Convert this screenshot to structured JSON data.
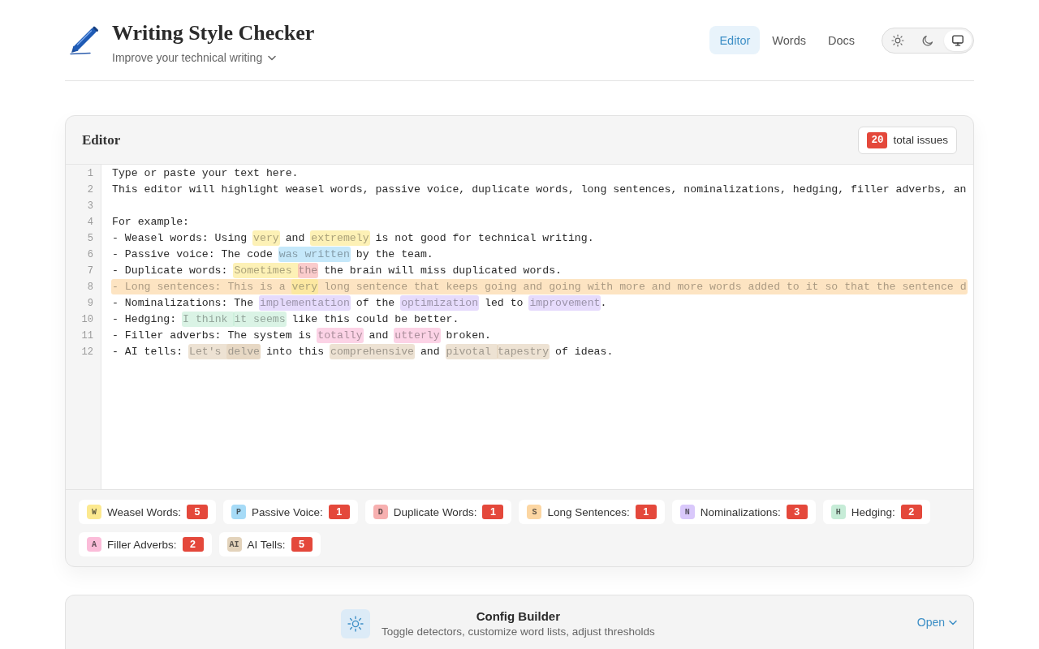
{
  "header": {
    "title": "Writing Style Checker",
    "subtitle": "Improve your technical writing",
    "nav": [
      {
        "label": "Editor",
        "selected": true
      },
      {
        "label": "Words",
        "selected": false
      },
      {
        "label": "Docs",
        "selected": false
      }
    ],
    "theme_modes": [
      {
        "kind": "light",
        "selected": false
      },
      {
        "kind": "dark",
        "selected": false
      },
      {
        "kind": "system",
        "selected": true
      }
    ]
  },
  "editor": {
    "title": "Editor",
    "issue_count": "20",
    "issue_label": "total issues",
    "lines": [
      {
        "number": "1",
        "segments": [
          {
            "kind": "plain",
            "text": "Type or paste your text here."
          }
        ]
      },
      {
        "number": "2",
        "segments": [
          {
            "kind": "plain",
            "text": "This editor will highlight weasel words, passive voice, duplicate words, long sentences, nominalizations, hedging, filler adverbs, an"
          }
        ]
      },
      {
        "number": "3"
      },
      {
        "number": "4",
        "segments": [
          {
            "kind": "plain",
            "text": "For example:"
          }
        ]
      },
      {
        "number": "5",
        "segments": [
          {
            "kind": "plain",
            "text": "- Weasel words: Using "
          },
          {
            "kind": "weasel",
            "text": "very"
          },
          {
            "kind": "plain",
            "text": " and "
          },
          {
            "kind": "weasel",
            "text": "extremely"
          },
          {
            "kind": "plain",
            "text": " is not good for technical writing."
          }
        ]
      },
      {
        "number": "6",
        "segments": [
          {
            "kind": "plain",
            "text": "- Passive voice: The code "
          },
          {
            "kind": "passive",
            "text": "was written"
          },
          {
            "kind": "plain",
            "text": " by the team."
          }
        ]
      },
      {
        "number": "7",
        "segments": [
          {
            "kind": "plain",
            "text": "- Duplicate words: "
          },
          {
            "kind": "weasel",
            "text": "Sometimes "
          },
          {
            "kind": "duplicate",
            "text": "the"
          },
          {
            "kind": "plain",
            "text": " the brain will miss duplicated words."
          }
        ]
      },
      {
        "number": "8",
        "segments": [
          {
            "kind": "long",
            "segments": [
              {
                "kind": "plain",
                "text": "- Long sentences: This is a "
              },
              {
                "kind": "weasel",
                "text": "very"
              },
              {
                "kind": "plain",
                "text": " long sentence that keeps going and going with more and more words added to it so that the sentence d"
              }
            ]
          }
        ]
      },
      {
        "number": "9",
        "segments": [
          {
            "kind": "plain",
            "text": "- Nominalizations: The "
          },
          {
            "kind": "nominalization",
            "text": "implementation"
          },
          {
            "kind": "plain",
            "text": " of the "
          },
          {
            "kind": "nominalization",
            "text": "optimization"
          },
          {
            "kind": "plain",
            "text": " led to "
          },
          {
            "kind": "nominalization",
            "text": "improvement"
          },
          {
            "kind": "plain",
            "text": "."
          }
        ]
      },
      {
        "number": "10",
        "segments": [
          {
            "kind": "plain",
            "text": "- Hedging: "
          },
          {
            "kind": "hedging",
            "text": "I think "
          },
          {
            "kind": "hedging",
            "text": "it seems"
          },
          {
            "kind": "plain",
            "text": " like this could be better."
          }
        ]
      },
      {
        "number": "11",
        "segments": [
          {
            "kind": "plain",
            "text": "- Filler adverbs: The system is "
          },
          {
            "kind": "filler",
            "text": "totally"
          },
          {
            "kind": "plain",
            "text": " and "
          },
          {
            "kind": "filler",
            "text": "utterly"
          },
          {
            "kind": "plain",
            "text": " broken."
          }
        ]
      },
      {
        "number": "12",
        "segments": [
          {
            "kind": "plain",
            "text": "- AI tells: "
          },
          {
            "kind": "ai",
            "segments": [
              {
                "kind": "plain",
                "text": "Let's "
              },
              {
                "kind": "ai",
                "text": "delve"
              }
            ]
          },
          {
            "kind": "plain",
            "text": " into this "
          },
          {
            "kind": "ai",
            "text": "comprehensive"
          },
          {
            "kind": "plain",
            "text": " and "
          },
          {
            "kind": "ai",
            "text": "pivotal "
          },
          {
            "kind": "ai",
            "text": "tapestry"
          },
          {
            "kind": "plain",
            "text": " of ideas."
          }
        ]
      }
    ],
    "legend": [
      {
        "kind": "weasel",
        "letter": "W",
        "label": "Weasel Words:",
        "count": "5",
        "color": "#fce98f"
      },
      {
        "kind": "passive",
        "letter": "P",
        "label": "Passive Voice:",
        "count": "1",
        "color": "#a6dbf7"
      },
      {
        "kind": "duplicate",
        "letter": "D",
        "label": "Duplicate Words:",
        "count": "1",
        "color": "#f7b0b0"
      },
      {
        "kind": "long",
        "letter": "S",
        "label": "Long Sentences:",
        "count": "1",
        "color": "#fcd6a2"
      },
      {
        "kind": "nominalization",
        "letter": "N",
        "label": "Nominalizations:",
        "count": "3",
        "color": "#d9c8fb"
      },
      {
        "kind": "hedging",
        "letter": "H",
        "label": "Hedging:",
        "count": "2",
        "color": "#c6ecd7"
      },
      {
        "kind": "filler",
        "letter": "A",
        "label": "Filler Adverbs:",
        "count": "2",
        "color": "#fbbcd9"
      },
      {
        "kind": "ai",
        "letter": "AI",
        "label": "AI Tells:",
        "count": "5",
        "color": "#e3d3bb"
      }
    ]
  },
  "config_builder": {
    "title": "Config Builder",
    "description": "Toggle detectors, customize word lists, adjust thresholds",
    "action": "Open"
  }
}
